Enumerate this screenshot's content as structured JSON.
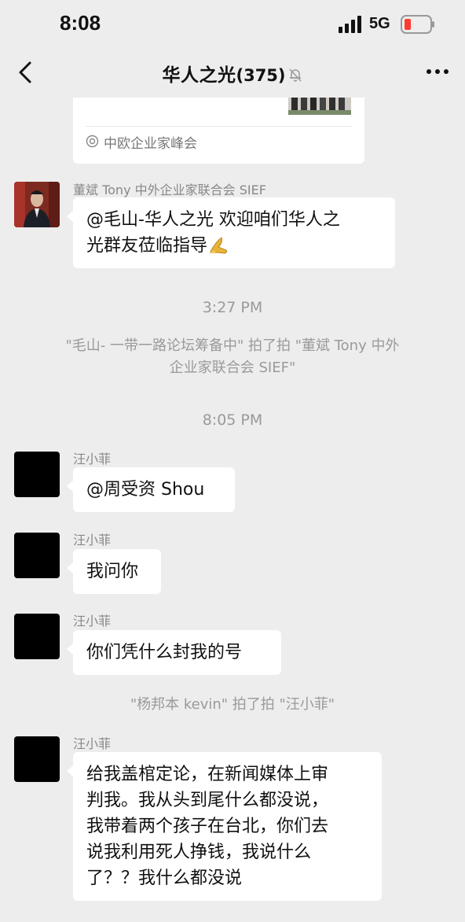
{
  "status_bar": {
    "time": "8:08",
    "network": "5G",
    "battery_color": "#ff3b30"
  },
  "nav": {
    "title": "华人之光",
    "member_count": "(375)",
    "back_icon": "chevron-left-icon",
    "more_icon": "more-dots-icon",
    "mute_icon": "bell-slash-icon"
  },
  "card": {
    "source": "中欧企业家峰会"
  },
  "messages": [
    {
      "sender": "董斌 Tony 中外企业家联合会 SIEF",
      "lines": [
        "@毛山-华人之光 欢迎咱们华人之",
        "光群友莅临指导"
      ]
    },
    {
      "sender": "汪小菲",
      "lines": [
        "@周受资 Shou"
      ]
    },
    {
      "sender": "汪小菲",
      "lines": [
        "我问你"
      ]
    },
    {
      "sender": "汪小菲",
      "lines": [
        "你们凭什么封我的号"
      ]
    },
    {
      "sender": "汪小菲",
      "lines": [
        "给我盖棺定论，在新闻媒体上审",
        "判我。我从头到尾什么都没说，",
        "我带着两个孩子在台北，你们去",
        "说我利用死人挣钱，我说什么",
        "了？？我什么都没说"
      ]
    }
  ],
  "timestamps": [
    "3:27 PM",
    "8:05 PM"
  ],
  "system": {
    "pat1_lines": [
      "\"毛山- 一带一路论坛筹备中\" 拍了拍 \"董斌 Tony 中外",
      "企业家联合会 SIEF\""
    ],
    "pat2": "\"杨邦本 kevin\" 拍了拍 \"汪小菲\""
  }
}
